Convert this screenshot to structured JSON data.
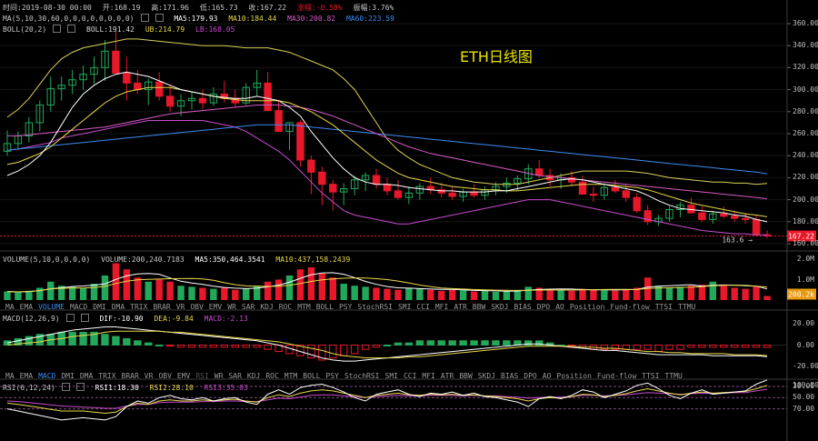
{
  "watermark": "ETH日线图",
  "info_bar": {
    "time": "时间:2019-08-30 00:00",
    "open": "开:168.19",
    "high": "高:171.96",
    "low": "低:165.73",
    "close": "收:167.22",
    "change": "涨幅:-0.58%",
    "amplitude": "振幅:3.76%"
  },
  "ma_legend": {
    "params": "MA(5,10,30,60,0,0,0,0,0,0,0,0)",
    "ma5": "MA5:179.93",
    "ma10": "MA10:184.44",
    "ma30": "MA30:200.82",
    "ma60": "MA60:223.59"
  },
  "boll_legend": {
    "params": "BOLL(20,2)",
    "boll": "BOLL:191.42",
    "ub": "UB:214.79",
    "lb": "LB:168.05"
  },
  "volume_legend": {
    "params": "VOLUME(5,10,0,0,0,0)",
    "volume": "VOLUME:200,240.7183",
    "ma5": "MA5:350,464.3541",
    "ma10": "MA10:437,158.2439"
  },
  "macd_legend": {
    "params": "MACD(12,26,9)",
    "dif": "DIF:-10.90",
    "dea": "DEA:-9.84",
    "macd": "MACD:-2.13"
  },
  "rsi_legend": {
    "params": "RSI(6,12,24)",
    "rsi1": "RSI1:18.30",
    "rsi2": "RSI2:28.10",
    "rsi3": "RSI3:35.03"
  },
  "indicator_tabs_1": [
    "MA",
    "EMA",
    "VOLUME",
    "MACD",
    "DMI",
    "DMA",
    "TRIX",
    "BRAR",
    "VR",
    "OBV",
    "EMV",
    "WR",
    "SAR",
    "KDJ",
    "ROC",
    "MTM",
    "BOLL",
    "PSY",
    "StochRSI",
    "SMI",
    "CCI",
    "MFI",
    "ATR",
    "BBW",
    "SKDJ",
    "BIAS",
    "DPO",
    "AO",
    "Position",
    "Fund-flow",
    "TTSI",
    "TTMU"
  ],
  "indicator_tabs_1_active": "VOLUME",
  "indicator_tabs_2": [
    "MA",
    "EMA",
    "MACD",
    "DMI",
    "DMA",
    "TRIX",
    "BRAR",
    "VR",
    "OBV",
    "EMV",
    "RSI",
    "WR",
    "SAR",
    "KDJ",
    "ROC",
    "MTM",
    "BOLL",
    "PSY",
    "StochRSI",
    "SMI",
    "CCI",
    "MFI",
    "ATR",
    "BBW",
    "SKDJ",
    "BIAS",
    "DPO",
    "AO",
    "Position",
    "Fund-flow",
    "TTSI",
    "TTMU"
  ],
  "indicator_tabs_2_active": "MACD",
  "indicator_tabs_2_dim": "RSI",
  "price_axis_labels": [
    "360.00",
    "340.00",
    "320.00",
    "300.00",
    "280.00",
    "260.00",
    "240.00",
    "220.00",
    "200.00",
    "180.00",
    "160.00"
  ],
  "volume_axis_labels": [
    "2.0M",
    "1.0M"
  ],
  "macd_axis_labels": [
    "20.00",
    "0.00",
    "-20.00"
  ],
  "rsi_axis_labels": [
    "100.00",
    "70.00",
    "50.00",
    "30.00"
  ],
  "current_price_label": "167.22",
  "current_volume_label": "200.2k",
  "low_marker_label": "163.6 →",
  "colors": {
    "up": "#22a85a",
    "down": "#e8182a",
    "ma5": "#ffffff",
    "ma10": "#e8d84a",
    "ma30": "#d85ac8",
    "ma60": "#3c8cf0",
    "boll_mid": "#d8d8d8",
    "boll_ub": "#d8d055",
    "boll_lb": "#c84ad0",
    "macd_dif": "#ffffff",
    "macd_dea": "#e8d84a",
    "rsi1": "#ffffff",
    "rsi2": "#e8d84a",
    "rsi3": "#c84ad0",
    "rsi_band": "#3a0a3a",
    "watermark": "#e8e600",
    "price_tag": "#e8182a",
    "volume_tag": "#e89a10"
  },
  "chart_data": {
    "type": "candlestick",
    "title": "ETH日线图",
    "price_ylim": [
      160,
      360
    ],
    "volume_ylim": [
      0,
      2000000
    ],
    "macd_ylim": [
      -20,
      20
    ],
    "rsi_ylim": [
      20,
      100
    ],
    "candles": [
      [
        244,
        263,
        240,
        251
      ],
      [
        251,
        262,
        246,
        258
      ],
      [
        258,
        275,
        252,
        270
      ],
      [
        270,
        290,
        262,
        286
      ],
      [
        286,
        312,
        280,
        301
      ],
      [
        301,
        312,
        290,
        304
      ],
      [
        304,
        318,
        296,
        309
      ],
      [
        309,
        322,
        300,
        314
      ],
      [
        314,
        330,
        305,
        320
      ],
      [
        320,
        345,
        308,
        335
      ],
      [
        335,
        353,
        320,
        315
      ],
      [
        315,
        330,
        290,
        306
      ],
      [
        306,
        318,
        296,
        300
      ],
      [
        300,
        310,
        286,
        307
      ],
      [
        307,
        316,
        290,
        294
      ],
      [
        294,
        305,
        280,
        285
      ],
      [
        285,
        296,
        276,
        290
      ],
      [
        290,
        298,
        282,
        292
      ],
      [
        292,
        300,
        282,
        288
      ],
      [
        288,
        302,
        285,
        296
      ],
      [
        296,
        308,
        288,
        292
      ],
      [
        292,
        300,
        284,
        288
      ],
      [
        288,
        306,
        286,
        302
      ],
      [
        302,
        318,
        294,
        306
      ],
      [
        306,
        316,
        290,
        281
      ],
      [
        281,
        290,
        264,
        262
      ],
      [
        262,
        270,
        245,
        270
      ],
      [
        270,
        272,
        230,
        236
      ],
      [
        236,
        240,
        205,
        225
      ],
      [
        225,
        230,
        195,
        214
      ],
      [
        214,
        218,
        190,
        207
      ],
      [
        207,
        215,
        195,
        210
      ],
      [
        210,
        222,
        204,
        218
      ],
      [
        218,
        225,
        208,
        222
      ],
      [
        222,
        228,
        210,
        214
      ],
      [
        214,
        220,
        204,
        208
      ],
      [
        208,
        218,
        200,
        202
      ],
      [
        202,
        212,
        196,
        206
      ],
      [
        206,
        215,
        200,
        212
      ],
      [
        212,
        220,
        205,
        209
      ],
      [
        209,
        215,
        202,
        206
      ],
      [
        206,
        212,
        200,
        203
      ],
      [
        203,
        210,
        198,
        207
      ],
      [
        207,
        214,
        202,
        204
      ],
      [
        204,
        212,
        200,
        209
      ],
      [
        209,
        216,
        204,
        212
      ],
      [
        212,
        220,
        206,
        215
      ],
      [
        215,
        222,
        208,
        219
      ],
      [
        219,
        232,
        214,
        228
      ],
      [
        228,
        236,
        220,
        222
      ],
      [
        222,
        228,
        212,
        218
      ],
      [
        218,
        224,
        210,
        220
      ],
      [
        220,
        226,
        212,
        216
      ],
      [
        216,
        222,
        206,
        205
      ],
      [
        205,
        212,
        198,
        204
      ],
      [
        204,
        215,
        200,
        211
      ],
      [
        211,
        218,
        206,
        208
      ],
      [
        208,
        214,
        198,
        202
      ],
      [
        202,
        206,
        188,
        190
      ],
      [
        190,
        195,
        177,
        180
      ],
      [
        180,
        186,
        176,
        183
      ],
      [
        183,
        194,
        180,
        191
      ],
      [
        191,
        198,
        184,
        195
      ],
      [
        195,
        202,
        190,
        188
      ],
      [
        188,
        194,
        180,
        182
      ],
      [
        182,
        190,
        178,
        187
      ],
      [
        187,
        194,
        183,
        185
      ],
      [
        185,
        190,
        180,
        183
      ],
      [
        183,
        188,
        178,
        182
      ],
      [
        182,
        186,
        170,
        168
      ],
      [
        168,
        172,
        165,
        167
      ]
    ],
    "volumes": [
      420000,
      380000,
      450000,
      600000,
      900000,
      700000,
      650000,
      600000,
      800000,
      1200000,
      1800000,
      1500000,
      1100000,
      900000,
      1000000,
      900000,
      700000,
      650000,
      600000,
      550000,
      600000,
      500000,
      550000,
      700000,
      900000,
      1000000,
      1200000,
      1500000,
      1600000,
      1300000,
      1100000,
      800000,
      700000,
      650000,
      600000,
      550000,
      500000,
      600000,
      550000,
      500000,
      450000,
      500000,
      480000,
      420000,
      450000,
      400000,
      420000,
      500000,
      650000,
      600000,
      500000,
      480000,
      450000,
      550000,
      520000,
      480000,
      460000,
      520000,
      600000,
      1100000,
      700000,
      600000,
      650000,
      700000,
      750000,
      900000,
      700000,
      600000,
      550000,
      650000,
      200240
    ],
    "ma5_line": [
      222,
      226,
      232,
      240,
      252,
      268,
      284,
      296,
      304,
      310,
      314,
      316,
      314,
      312,
      308,
      304,
      300,
      298,
      296,
      294,
      293,
      292,
      292,
      294,
      292,
      290,
      284,
      276,
      262,
      250,
      238,
      228,
      220,
      216,
      214,
      214,
      213,
      211,
      210,
      209,
      208,
      208,
      207,
      207,
      207,
      208,
      208,
      210,
      212,
      214,
      216,
      218,
      219,
      218,
      216,
      214,
      212,
      210,
      208,
      204,
      199,
      195,
      192,
      191,
      190,
      189,
      188,
      186,
      185,
      182,
      179.93
    ],
    "ma10_line": [
      232,
      234,
      238,
      242,
      248,
      256,
      264,
      272,
      280,
      288,
      294,
      298,
      300,
      302,
      302,
      302,
      300,
      298,
      296,
      294,
      292,
      291,
      290,
      290,
      290,
      290,
      288,
      284,
      280,
      274,
      268,
      260,
      252,
      244,
      236,
      230,
      224,
      220,
      218,
      216,
      214,
      212,
      211,
      210,
      209,
      209,
      208,
      208,
      209,
      210,
      211,
      212,
      213,
      214,
      214,
      214,
      213,
      212,
      211,
      209,
      206,
      203,
      200,
      197,
      195,
      193,
      191,
      189,
      187,
      186,
      184.44
    ],
    "ma30_line": [
      258,
      258,
      259,
      260,
      261,
      262,
      263,
      264,
      265,
      266,
      268,
      270,
      272,
      274,
      276,
      278,
      279,
      280,
      281,
      282,
      283,
      284,
      285,
      286,
      286,
      286,
      285,
      284,
      282,
      279,
      276,
      272,
      268,
      264,
      260,
      256,
      252,
      248,
      245,
      242,
      240,
      238,
      236,
      234,
      232,
      230,
      228,
      226,
      224,
      222,
      221,
      220,
      219,
      218,
      217,
      216,
      215,
      214,
      213,
      212,
      211,
      210,
      209,
      208,
      207,
      206,
      205,
      204,
      203,
      202,
      200.82
    ],
    "ma60_line": [
      245,
      246,
      247,
      248,
      249,
      250,
      251,
      252,
      253,
      254,
      255,
      256,
      257,
      258,
      259,
      260,
      261,
      262,
      263,
      264,
      265,
      266,
      267,
      268,
      268,
      268,
      268,
      267,
      266,
      265,
      264,
      263,
      262,
      261,
      260,
      259,
      258,
      257,
      256,
      255,
      254,
      253,
      252,
      251,
      250,
      249,
      248,
      247,
      246,
      245,
      244,
      243,
      242,
      241,
      240,
      239,
      238,
      237,
      236,
      235,
      234,
      233,
      232,
      231,
      230,
      229,
      228,
      227,
      226,
      225,
      223.59
    ],
    "boll_ub_line": [
      275,
      282,
      292,
      305,
      318,
      328,
      334,
      338,
      340,
      342,
      344,
      346,
      346,
      345,
      344,
      343,
      342,
      341,
      340,
      340,
      340,
      339,
      338,
      338,
      338,
      336,
      334,
      330,
      326,
      322,
      318,
      310,
      300,
      285,
      270,
      255,
      245,
      238,
      232,
      228,
      224,
      220,
      218,
      216,
      215,
      214,
      214,
      214,
      216,
      218,
      220,
      222,
      224,
      226,
      226,
      226,
      226,
      226,
      225,
      224,
      222,
      220,
      219,
      218,
      217,
      216,
      216,
      215,
      215,
      214,
      214.79
    ],
    "boll_lb_line": [
      245,
      246,
      248,
      250,
      252,
      256,
      258,
      260,
      262,
      264,
      266,
      268,
      270,
      272,
      272,
      272,
      272,
      272,
      272,
      270,
      268,
      266,
      262,
      256,
      250,
      244,
      236,
      226,
      216,
      206,
      198,
      190,
      186,
      184,
      182,
      180,
      178,
      178,
      180,
      182,
      184,
      186,
      188,
      190,
      192,
      194,
      196,
      198,
      200,
      200,
      200,
      198,
      196,
      194,
      192,
      190,
      188,
      186,
      184,
      182,
      180,
      178,
      176,
      174,
      172,
      171,
      170,
      169,
      169,
      168,
      168.05
    ],
    "macd_dif": [
      2,
      4,
      6,
      8,
      10,
      12,
      14,
      15,
      16,
      17,
      17,
      16,
      15,
      14,
      13,
      12,
      11,
      10,
      9,
      8,
      7,
      6,
      5,
      4,
      2,
      0,
      -3,
      -6,
      -9,
      -12,
      -14,
      -15,
      -15,
      -14,
      -13,
      -12,
      -11,
      -10,
      -9,
      -8,
      -7,
      -6,
      -5,
      -4,
      -3,
      -2,
      -1,
      0,
      1,
      1,
      0,
      -1,
      -2,
      -3,
      -4,
      -5,
      -5,
      -6,
      -7,
      -8,
      -9,
      -9,
      -9,
      -9,
      -9,
      -10,
      -10,
      -10,
      -10,
      -10,
      -10.9
    ],
    "macd_dea": [
      0,
      1,
      2,
      3,
      5,
      6,
      8,
      9,
      10,
      12,
      13,
      13,
      13,
      13,
      13,
      12,
      12,
      11,
      10,
      9,
      8,
      7,
      6,
      5,
      4,
      3,
      1,
      -1,
      -3,
      -5,
      -8,
      -10,
      -11,
      -12,
      -12,
      -12,
      -12,
      -11,
      -11,
      -10,
      -9,
      -8,
      -7,
      -6,
      -5,
      -4,
      -3,
      -2,
      -1,
      -1,
      -1,
      -1,
      -1,
      -2,
      -2,
      -3,
      -3,
      -4,
      -5,
      -6,
      -6,
      -7,
      -7,
      -8,
      -8,
      -8,
      -8,
      -9,
      -9,
      -9,
      -9.84
    ],
    "macd_hist": [
      4,
      6,
      8,
      10,
      10,
      12,
      12,
      12,
      12,
      10,
      8,
      6,
      4,
      2,
      0,
      -1,
      -2,
      -2,
      -2,
      -2,
      -2,
      -2,
      -2,
      -2,
      -4,
      -6,
      -8,
      -10,
      -12,
      -14,
      -12,
      -10,
      -8,
      -4,
      -2,
      0,
      2,
      2,
      4,
      4,
      4,
      4,
      4,
      4,
      4,
      4,
      4,
      4,
      4,
      4,
      2,
      0,
      -2,
      -2,
      -4,
      -4,
      -4,
      -4,
      -4,
      -4,
      -6,
      -4,
      -4,
      -2,
      -2,
      -2,
      -2,
      -2,
      -2,
      -2,
      -2.13
    ],
    "rsi1": [
      70,
      74,
      78,
      82,
      86,
      90,
      88,
      86,
      88,
      90,
      84,
      66,
      56,
      60,
      50,
      46,
      52,
      54,
      50,
      56,
      52,
      50,
      58,
      62,
      44,
      36,
      44,
      32,
      28,
      26,
      32,
      40,
      50,
      56,
      44,
      40,
      36,
      44,
      48,
      42,
      44,
      40,
      46,
      42,
      48,
      50,
      54,
      58,
      66,
      52,
      48,
      52,
      46,
      36,
      40,
      50,
      44,
      38,
      28,
      24,
      34,
      46,
      52,
      42,
      36,
      44,
      42,
      40,
      38,
      26,
      18.3
    ],
    "rsi2": [
      60,
      62,
      65,
      68,
      71,
      74,
      74,
      74,
      76,
      78,
      76,
      66,
      60,
      62,
      56,
      54,
      56,
      56,
      54,
      56,
      54,
      53,
      56,
      58,
      50,
      45,
      48,
      42,
      38,
      36,
      38,
      42,
      46,
      50,
      46,
      44,
      42,
      45,
      46,
      44,
      45,
      44,
      46,
      45,
      47,
      48,
      50,
      52,
      56,
      52,
      50,
      51,
      48,
      44,
      45,
      48,
      46,
      43,
      38,
      34,
      38,
      42,
      45,
      42,
      40,
      42,
      41,
      40,
      39,
      34,
      28.1
    ],
    "rsi3": [
      56,
      57,
      59,
      61,
      63,
      65,
      66,
      67,
      68,
      69,
      69,
      65,
      62,
      62,
      59,
      58,
      58,
      58,
      57,
      57,
      56,
      56,
      57,
      57,
      54,
      51,
      52,
      49,
      46,
      45,
      45,
      47,
      48,
      50,
      48,
      47,
      46,
      47,
      47,
      46,
      46,
      46,
      47,
      46,
      47,
      47,
      48,
      49,
      51,
      50,
      49,
      49,
      48,
      46,
      46,
      47,
      46,
      45,
      43,
      41,
      42,
      43,
      44,
      43,
      42,
      43,
      42,
      41,
      41,
      38,
      35.03
    ]
  }
}
